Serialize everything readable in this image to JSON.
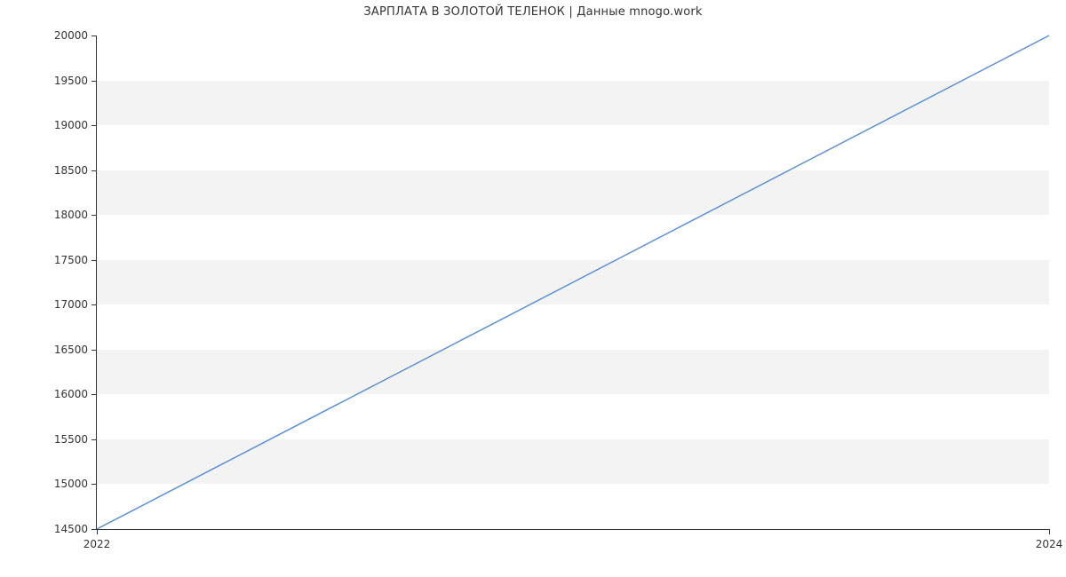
{
  "chart_data": {
    "type": "line",
    "title": "ЗАРПЛАТА В  ЗОЛОТОЙ ТЕЛЕНОК | Данные mnogo.work",
    "xlabel": "",
    "ylabel": "",
    "x": [
      2022,
      2024
    ],
    "values": [
      14500,
      20000
    ],
    "x_ticks": [
      2022,
      2024
    ],
    "y_ticks": [
      14500,
      15000,
      15500,
      16000,
      16500,
      17000,
      17500,
      18000,
      18500,
      19000,
      19500,
      20000
    ],
    "xlim": [
      2022,
      2024
    ],
    "ylim": [
      14500,
      20000
    ],
    "line_color": "#5a8fd6",
    "grid": "banded"
  }
}
